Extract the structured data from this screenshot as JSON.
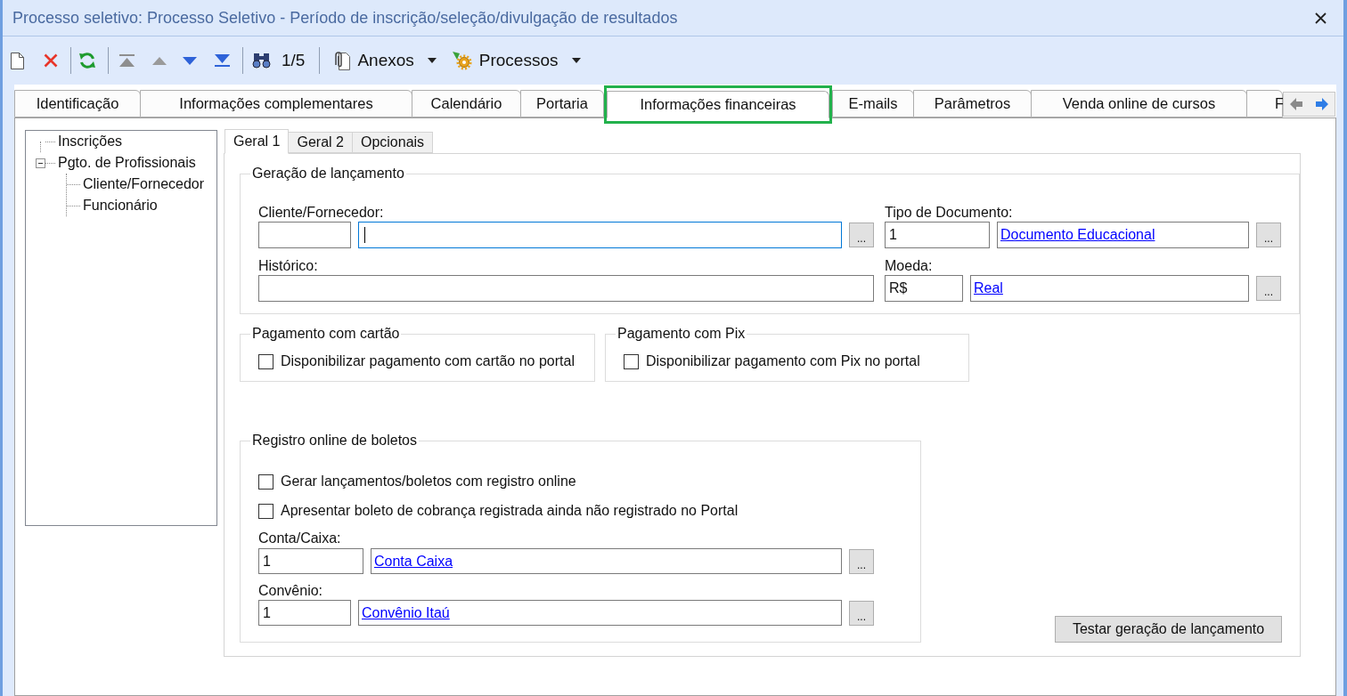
{
  "window": {
    "title": "Processo seletivo: Processo Seletivo - Período de inscrição/seleção/divulgação de resultados"
  },
  "toolbar": {
    "record_counter": "1/5",
    "menus": [
      {
        "label": "Anexos"
      },
      {
        "label": "Processos"
      }
    ]
  },
  "tabs": [
    {
      "label": "Identificação",
      "selected": false,
      "highlighted": false
    },
    {
      "label": "Informações complementares",
      "selected": false,
      "highlighted": false
    },
    {
      "label": "Calendário",
      "selected": false,
      "highlighted": false
    },
    {
      "label": "Portaria",
      "selected": false,
      "highlighted": false
    },
    {
      "label": "Informações financeiras",
      "selected": true,
      "highlighted": true
    },
    {
      "label": "E-mails",
      "selected": false,
      "highlighted": false
    },
    {
      "label": "Parâmetros",
      "selected": false,
      "highlighted": false
    },
    {
      "label": "Venda online de cursos",
      "selected": false,
      "highlighted": false
    },
    {
      "label": "F",
      "selected": false,
      "highlighted": false
    }
  ],
  "tree": [
    {
      "label": "Inscrições"
    },
    {
      "label": "Pgto. de Profissionais",
      "expanded": true,
      "children": [
        {
          "label": "Cliente/Fornecedor"
        },
        {
          "label": "Funcionário"
        }
      ]
    }
  ],
  "subtabs": [
    {
      "label": "Geral 1",
      "selected": true
    },
    {
      "label": "Geral 2",
      "selected": false
    },
    {
      "label": "Opcionais",
      "selected": false
    }
  ],
  "launch_generation": {
    "title": "Geração de lançamento",
    "fields": [
      {
        "kind": "lookup",
        "label": "Cliente/Fornecedor:",
        "focused": true,
        "button": "..."
      },
      {
        "kind": "lookup",
        "label": "Tipo de Documento:",
        "code": "1",
        "description": "Documento Educacional",
        "focused": false,
        "button": "..."
      },
      {
        "kind": "text",
        "label": "Histórico:",
        "focused": false
      },
      {
        "kind": "lookup",
        "label": "Moeda:",
        "code": "R$",
        "description": "Real",
        "focused": false,
        "button": "..."
      }
    ]
  },
  "payment_groups": [
    {
      "title": "Pagamento com cartão",
      "option": {
        "label": "Disponibilizar pagamento com cartão no portal",
        "checked": false
      }
    },
    {
      "title": "Pagamento com Pix",
      "option": {
        "label": "Disponibilizar pagamento com Pix no portal",
        "checked": false
      }
    }
  ],
  "online_registration": {
    "title": "Registro online de boletos",
    "options": [
      {
        "label": "Gerar lançamentos/boletos com registro online",
        "checked": false
      },
      {
        "label": "Apresentar boleto de cobrança registrada ainda não registrado no Portal",
        "checked": false
      }
    ],
    "fields": [
      {
        "kind": "lookup",
        "label": "Conta/Caixa:",
        "code": "1",
        "description": "Conta Caixa",
        "focused": false,
        "button": "..."
      },
      {
        "kind": "lookup",
        "label": "Convênio:",
        "code": "1",
        "description": "Convênio Itaú",
        "focused": false,
        "button": "..."
      }
    ]
  },
  "test_button": "Testar geração de lançamento"
}
